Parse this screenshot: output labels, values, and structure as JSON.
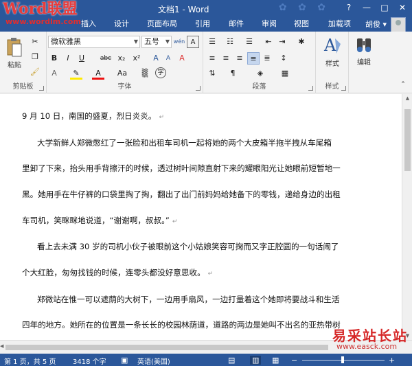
{
  "window": {
    "title": "文档1 - Word",
    "minimize": "—",
    "restore": "□",
    "close": "✕",
    "help": "?"
  },
  "logo": {
    "brand": "Word联盟",
    "url": "www.wordlm.com"
  },
  "tabs": [
    {
      "label": "插入"
    },
    {
      "label": "设计"
    },
    {
      "label": "页面布局"
    },
    {
      "label": "引用"
    },
    {
      "label": "邮件"
    },
    {
      "label": "审阅"
    },
    {
      "label": "视图"
    },
    {
      "label": "加载项"
    }
  ],
  "user": {
    "name": "胡俊 ▾"
  },
  "ribbon": {
    "clipboard": {
      "label": "剪贴板",
      "paste": "粘贴"
    },
    "font": {
      "label": "字体",
      "font_name": "微软雅黑",
      "font_size": "五号",
      "bold": "B",
      "italic": "I",
      "underline": "U",
      "strike": "abc",
      "subscript": "x₂",
      "superscript": "x²",
      "font_color": "A",
      "change_case": "Aa",
      "grow": "A",
      "shrink": "A",
      "clear": "A",
      "phonetic": "wén",
      "border_char": "A"
    },
    "paragraph": {
      "label": "段落"
    },
    "styles": {
      "label": "样式",
      "styles_btn": "样式"
    },
    "editing": {
      "editing_btn": "编辑"
    }
  },
  "document": {
    "lines": [
      "9 月 10 日，南国的盛夏，烈日炎炎。",
      "大学新鲜人郑微憋红了一张脸和出租车司机一起将她的两个大皮箱半拖半拽从车尾箱",
      "里卸了下来，抬头用手背擦汗的时候，透过树叶间隙直射下来的耀眼阳光让她眼前短暂地一",
      "黑。她用手在牛仔裤的口袋里掏了掏，翻出了出门前妈妈给她备下的零钱，递给身边的出租",
      "车司机，笑眯眯地说道，“谢谢啊，叔叔。”",
      "看上去未满 30 岁的司机小伙子被眼前这个小姑娘笑容可掬而又字正腔圆的一句话闹了",
      "个大红脸，匆匆找钱的时候，连零头都没好意思收。",
      "郑微站在惟一可以遮荫的大树下，一边用手扇风，一边打量着这个她即将要战斗和生活",
      "四年的地方。她所在的位置是一条长长的校园林荫道，道路的两边是她叫不出名的亚热带树"
    ],
    "para_mark": "↵"
  },
  "watermark": {
    "brand": "易采站长站",
    "url": "www.easck.com"
  },
  "status": {
    "page": "第 1 页，共 5 页",
    "words": "3418 个字",
    "language": "英语(美国)"
  }
}
